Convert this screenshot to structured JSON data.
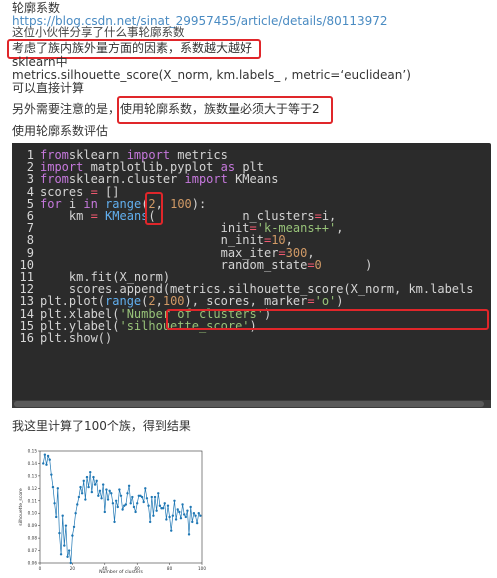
{
  "article": {
    "title": "轮廓系数",
    "link": "https://blog.csdn.net/sinat_29957455/article/details/80113972",
    "overlay_text": "这位小伙伴分享了什么事轮廓系数",
    "highlight1": "考虑了族内族外量方面的因素，系数越大越好",
    "sklearn_label": "sklearn中",
    "function_line": "metrics.silhouette_score(X_norm, km.labels_ , metric=‘euclidean’)",
    "direct_calc": "可以直接计算",
    "note_prefix": "另外需要注意的是，",
    "highlight2": "使用轮廓系数，族数量必须大于等于2",
    "eval_label": "使用轮廓系数评估",
    "result_text": "我这里计算了100个族，得到结果"
  },
  "code": {
    "line_numbers": [
      "1",
      "2",
      "3",
      "4",
      "5",
      "6",
      "7",
      "8",
      "9",
      "10",
      "11",
      "12",
      "13",
      "14",
      "15",
      "16"
    ],
    "lines": [
      [
        [
          "kw",
          "from"
        ],
        [
          "",
          "sklearn "
        ],
        [
          "kw",
          "import"
        ],
        [
          "",
          " metrics"
        ]
      ],
      [
        [
          "kw",
          "import"
        ],
        [
          "",
          " matplotlib.pyplot "
        ],
        [
          "kw",
          "as"
        ],
        [
          "",
          " plt"
        ]
      ],
      [
        [
          "kw",
          "from"
        ],
        [
          "",
          "sklearn.cluster "
        ],
        [
          "kw",
          "import"
        ],
        [
          "",
          " KMeans"
        ]
      ],
      [
        [
          "",
          "scores "
        ],
        [
          "op",
          "="
        ],
        [
          "",
          " []"
        ]
      ],
      [
        [
          "kw",
          "for"
        ],
        [
          "",
          " i "
        ],
        [
          "kw",
          "in"
        ],
        [
          "",
          " "
        ],
        [
          "fn",
          "range"
        ],
        [
          "",
          "("
        ],
        [
          "num",
          "2"
        ],
        [
          "",
          ", "
        ],
        [
          "num",
          "100"
        ],
        [
          "",
          "):"
        ]
      ],
      [
        [
          "",
          "    km "
        ],
        [
          "op",
          "="
        ],
        [
          "",
          " "
        ],
        [
          "fn",
          "KMeans"
        ],
        [
          "",
          "(            n_clusters"
        ],
        [
          "op",
          "="
        ],
        [
          "",
          "i,"
        ]
      ],
      [
        [
          "",
          "                         init"
        ],
        [
          "op",
          "="
        ],
        [
          "str",
          "'k-means++'"
        ],
        [
          "",
          ","
        ]
      ],
      [
        [
          "",
          "                         n_init"
        ],
        [
          "op",
          "="
        ],
        [
          "num",
          "10"
        ],
        [
          "",
          ","
        ]
      ],
      [
        [
          "",
          "                         max_iter"
        ],
        [
          "op",
          "="
        ],
        [
          "num",
          "300"
        ],
        [
          "",
          ","
        ]
      ],
      [
        [
          "",
          "                         random_state"
        ],
        [
          "op",
          "="
        ],
        [
          "num",
          "0"
        ],
        [
          "",
          "      )"
        ]
      ],
      [
        [
          "",
          "    km.fit(X_norm)"
        ]
      ],
      [
        [
          "",
          "    scores.append(metrics.silhouette_score(X_norm, km.labels"
        ]
      ],
      [
        [
          "",
          "plt.plot("
        ],
        [
          "fn",
          "range"
        ],
        [
          "",
          "("
        ],
        [
          "num",
          "2"
        ],
        [
          "",
          ","
        ],
        [
          "num",
          "100"
        ],
        [
          "",
          "), scores, marker"
        ],
        [
          "op",
          "="
        ],
        [
          "str",
          "'o'"
        ],
        [
          "",
          ")"
        ]
      ],
      [
        [
          "",
          "plt.xlabel("
        ],
        [
          "str",
          "'Number of clusters'"
        ],
        [
          "",
          ")"
        ]
      ],
      [
        [
          "",
          "plt.ylabel("
        ],
        [
          "str",
          "'silhouette_score'"
        ],
        [
          "",
          ")"
        ]
      ],
      [
        [
          "",
          "plt.show()"
        ]
      ]
    ]
  },
  "chart_data": {
    "type": "line",
    "xlabel": "Number of clusters",
    "ylabel": "silhouette_score",
    "xlim": [
      0,
      100
    ],
    "ylim": [
      0.06,
      0.15
    ],
    "xticks": [
      "0",
      "20",
      "40",
      "60",
      "80",
      "100"
    ],
    "yticks": [
      "0.06",
      "0.07",
      "0.08",
      "0.09",
      "0.10",
      "0.11",
      "0.12",
      "0.13",
      "0.14",
      "0.15"
    ],
    "marker": "o",
    "color": "#1f77b4",
    "x": [
      2,
      3,
      4,
      5,
      6,
      7,
      8,
      9,
      10,
      11,
      12,
      13,
      14,
      15,
      16,
      17,
      18,
      19,
      20,
      21,
      22,
      23,
      24,
      25,
      26,
      27,
      28,
      29,
      30,
      31,
      32,
      33,
      34,
      35,
      36,
      37,
      38,
      39,
      40,
      41,
      42,
      43,
      44,
      45,
      46,
      47,
      48,
      49,
      50,
      51,
      52,
      53,
      54,
      55,
      56,
      57,
      58,
      59,
      60,
      61,
      62,
      63,
      64,
      65,
      66,
      67,
      68,
      69,
      70,
      71,
      72,
      73,
      74,
      75,
      76,
      77,
      78,
      79,
      80,
      81,
      82,
      83,
      84,
      85,
      86,
      87,
      88,
      89,
      90,
      91,
      92,
      93,
      94,
      95,
      96,
      97,
      98,
      99
    ],
    "values": [
      0.14,
      0.147,
      0.139,
      0.146,
      0.143,
      0.131,
      0.121,
      0.108,
      0.097,
      0.12,
      0.084,
      0.067,
      0.098,
      0.074,
      0.09,
      0.065,
      0.07,
      0.06,
      0.082,
      0.089,
      0.1,
      0.107,
      0.113,
      0.121,
      0.116,
      0.126,
      0.111,
      0.129,
      0.121,
      0.133,
      0.117,
      0.129,
      0.123,
      0.126,
      0.114,
      0.118,
      0.112,
      0.123,
      0.101,
      0.119,
      0.111,
      0.118,
      0.116,
      0.108,
      0.093,
      0.11,
      0.105,
      0.119,
      0.114,
      0.103,
      0.106,
      0.107,
      0.116,
      0.122,
      0.108,
      0.113,
      0.105,
      0.101,
      0.108,
      0.114,
      0.114,
      0.113,
      0.109,
      0.12,
      0.112,
      0.106,
      0.093,
      0.113,
      0.098,
      0.113,
      0.102,
      0.116,
      0.106,
      0.104,
      0.104,
      0.108,
      0.095,
      0.106,
      0.097,
      0.086,
      0.098,
      0.11,
      0.095,
      0.103,
      0.101,
      0.096,
      0.107,
      0.099,
      0.097,
      0.102,
      0.083,
      0.105,
      0.093,
      0.1,
      0.098,
      0.092,
      0.1,
      0.098
    ]
  }
}
